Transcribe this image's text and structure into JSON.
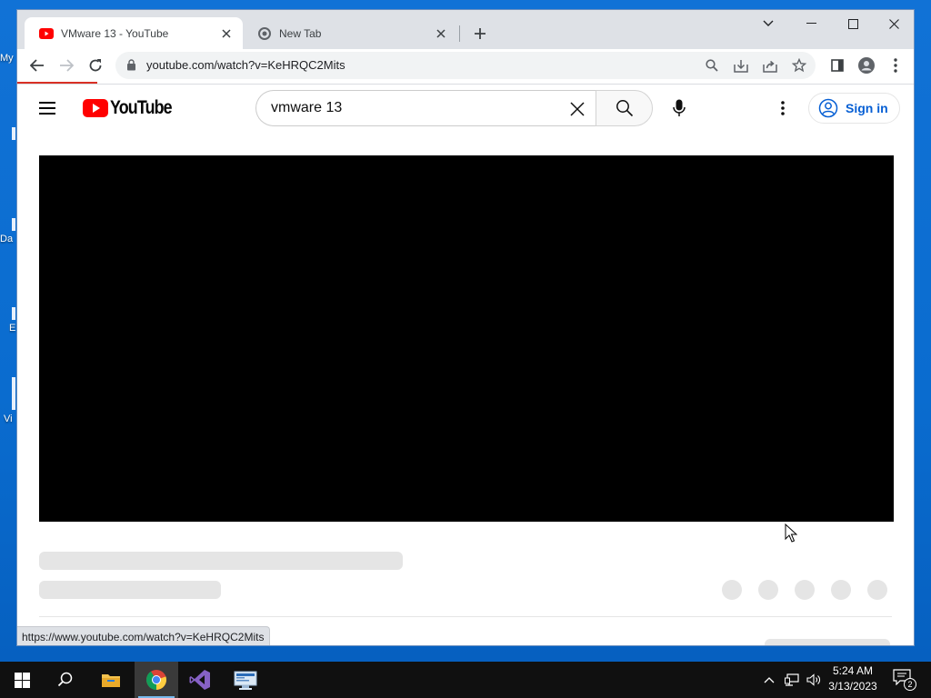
{
  "desktop": {
    "labels": [
      "My",
      "Da",
      "E",
      "Vi"
    ]
  },
  "browser": {
    "tabs": [
      {
        "title": "VMware 13 - YouTube",
        "active": true,
        "favicon": "youtube-icon"
      },
      {
        "title": "New Tab",
        "active": false,
        "favicon": "chrome-icon"
      }
    ],
    "url": "youtube.com/watch?v=KeHRQC2Mits",
    "status_url": "https://www.youtube.com/watch?v=KeHRQC2Mits",
    "page_loading": true
  },
  "youtube": {
    "logo_text": "YouTube",
    "search_query": "vmware 13",
    "sign_in_label": "Sign in"
  },
  "taskbar": {
    "apps": [
      "windows-start-icon",
      "search-icon",
      "file-explorer-icon",
      "chrome-icon",
      "visual-studio-icon",
      "remote-desktop-icon"
    ],
    "active_app": "chrome-icon",
    "time": "5:24 AM",
    "date": "3/13/2023",
    "notification_count": "2"
  },
  "colors": {
    "youtube_red": "#ff0000",
    "link_blue": "#065fd4",
    "desktop_blue": "#0b78d4",
    "tabstrip_gray": "#dee1e6"
  }
}
